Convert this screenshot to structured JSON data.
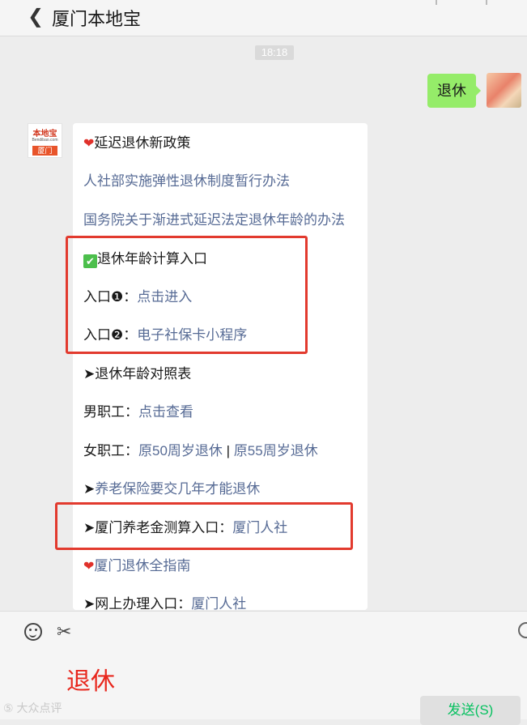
{
  "header": {
    "back_icon": "chevron-left-icon",
    "title": "厦门本地宝"
  },
  "chat": {
    "timestamp": "18:18",
    "my_message": "退休",
    "bot_avatar": {
      "brand": "本地宝",
      "domain": "Bendibao.com",
      "city": "厦门"
    },
    "bot_message": {
      "section1_title": "延迟退休新政策",
      "link1": "人社部实施弹性退休制度暂行办法",
      "link2": "国务院关于渐进式延迟法定退休年龄的办法",
      "section2_title": "退休年龄计算入口",
      "entry1_label": "入口❶：",
      "entry1_link": "点击进入",
      "entry2_label": "入口❷：",
      "entry2_link": "电子社保卡小程序",
      "table_title": "➤退休年龄对照表",
      "male_label": "男职工：",
      "male_link": "点击查看",
      "female_label": "女职工：",
      "female_link1": "原50周岁退休",
      "female_sep": " | ",
      "female_link2": "原55周岁退休",
      "pension_years_prefix": "➤",
      "pension_years_link": "养老保险要交几年才能退休",
      "calc_label": "➤厦门养老金测算入口：",
      "calc_link": "厦门人社",
      "guide_link": "厦门退休全指南",
      "online_label": "➤网上办理入口：",
      "online_link": "厦门人社"
    }
  },
  "input": {
    "emoji_icon": "emoji-icon",
    "scissor_icon": "scissor-icon",
    "typed_text": "退休",
    "send_label": "发送(S)"
  },
  "watermark": "⑤ 大众点评"
}
